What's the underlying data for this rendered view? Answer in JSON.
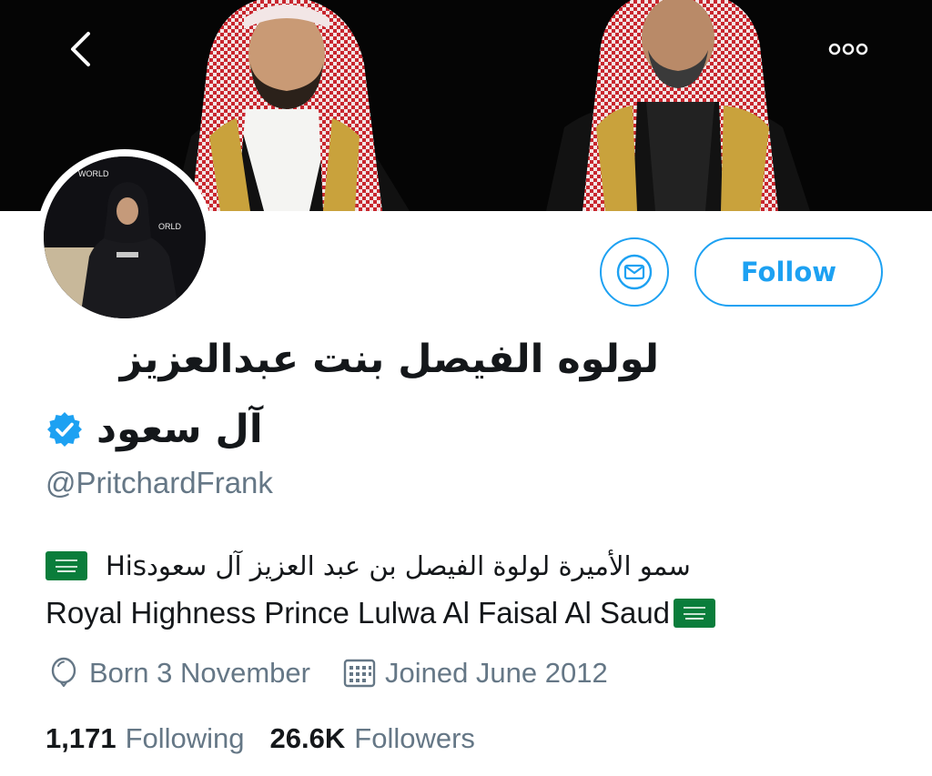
{
  "header": {
    "back_icon": "chevron-left-icon",
    "more_icon": "more-dots-icon"
  },
  "profile": {
    "name_line1": "لولوه الفيصل بنت عبدالعزيز",
    "name_line2": "آل سعود",
    "verified_icon": "verified-badge-icon",
    "handle": "@PritchardFrank",
    "bio_arabic": "سمو الأميرة لولوة الفيصل بن عبد العزيز آل سعودHis",
    "bio_english": "Royal Highness Prince Lulwa Al Faisal Al Saud",
    "flag_icon": "saudi-flag-icon"
  },
  "actions": {
    "message_icon": "envelope-icon",
    "follow_label": "Follow"
  },
  "meta": {
    "born_icon": "balloon-icon",
    "born_text": "Born 3 November",
    "joined_icon": "calendar-icon",
    "joined_text": "Joined June 2012"
  },
  "stats": {
    "following_count": "1,171",
    "following_label": "Following",
    "followers_count": "26.6K",
    "followers_label": "Followers"
  },
  "colors": {
    "accent": "#1da1f2",
    "secondary_text": "#657786",
    "primary_text": "#14171a",
    "flag_green": "#0a7d3b"
  }
}
